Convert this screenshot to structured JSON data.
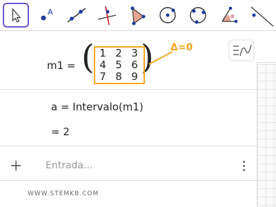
{
  "toolbar": {
    "tools": [
      {
        "name": "move-tool-icon",
        "selected": true
      },
      {
        "name": "point-tool-icon"
      },
      {
        "name": "line-tool-icon"
      },
      {
        "name": "perpendicular-line-tool-icon"
      },
      {
        "name": "polygon-tool-icon"
      },
      {
        "name": "circle-center-point-tool-icon"
      },
      {
        "name": "circle-three-points-tool-icon"
      },
      {
        "name": "angle-tool-icon"
      },
      {
        "name": "reflect-tool-icon"
      }
    ],
    "point_label": "A",
    "angle_label": "α"
  },
  "algebra": {
    "row1": {
      "label": "m1 =",
      "matrix": [
        [
          "1",
          "2",
          "3"
        ],
        [
          "4",
          "5",
          "6"
        ],
        [
          "7",
          "8",
          "9"
        ]
      ],
      "annotation": "Δ=0"
    },
    "row2": {
      "definition": "a = Intervalo(m1)",
      "result": "= 2"
    },
    "input": {
      "placeholder": "Entrada..."
    }
  },
  "watermark": "WWW.STEMKB.COM",
  "colors": {
    "accent": "#6557d2",
    "highlight": "#f5a623",
    "point_blue": "#1a3a9e",
    "red": "#d0021b"
  }
}
